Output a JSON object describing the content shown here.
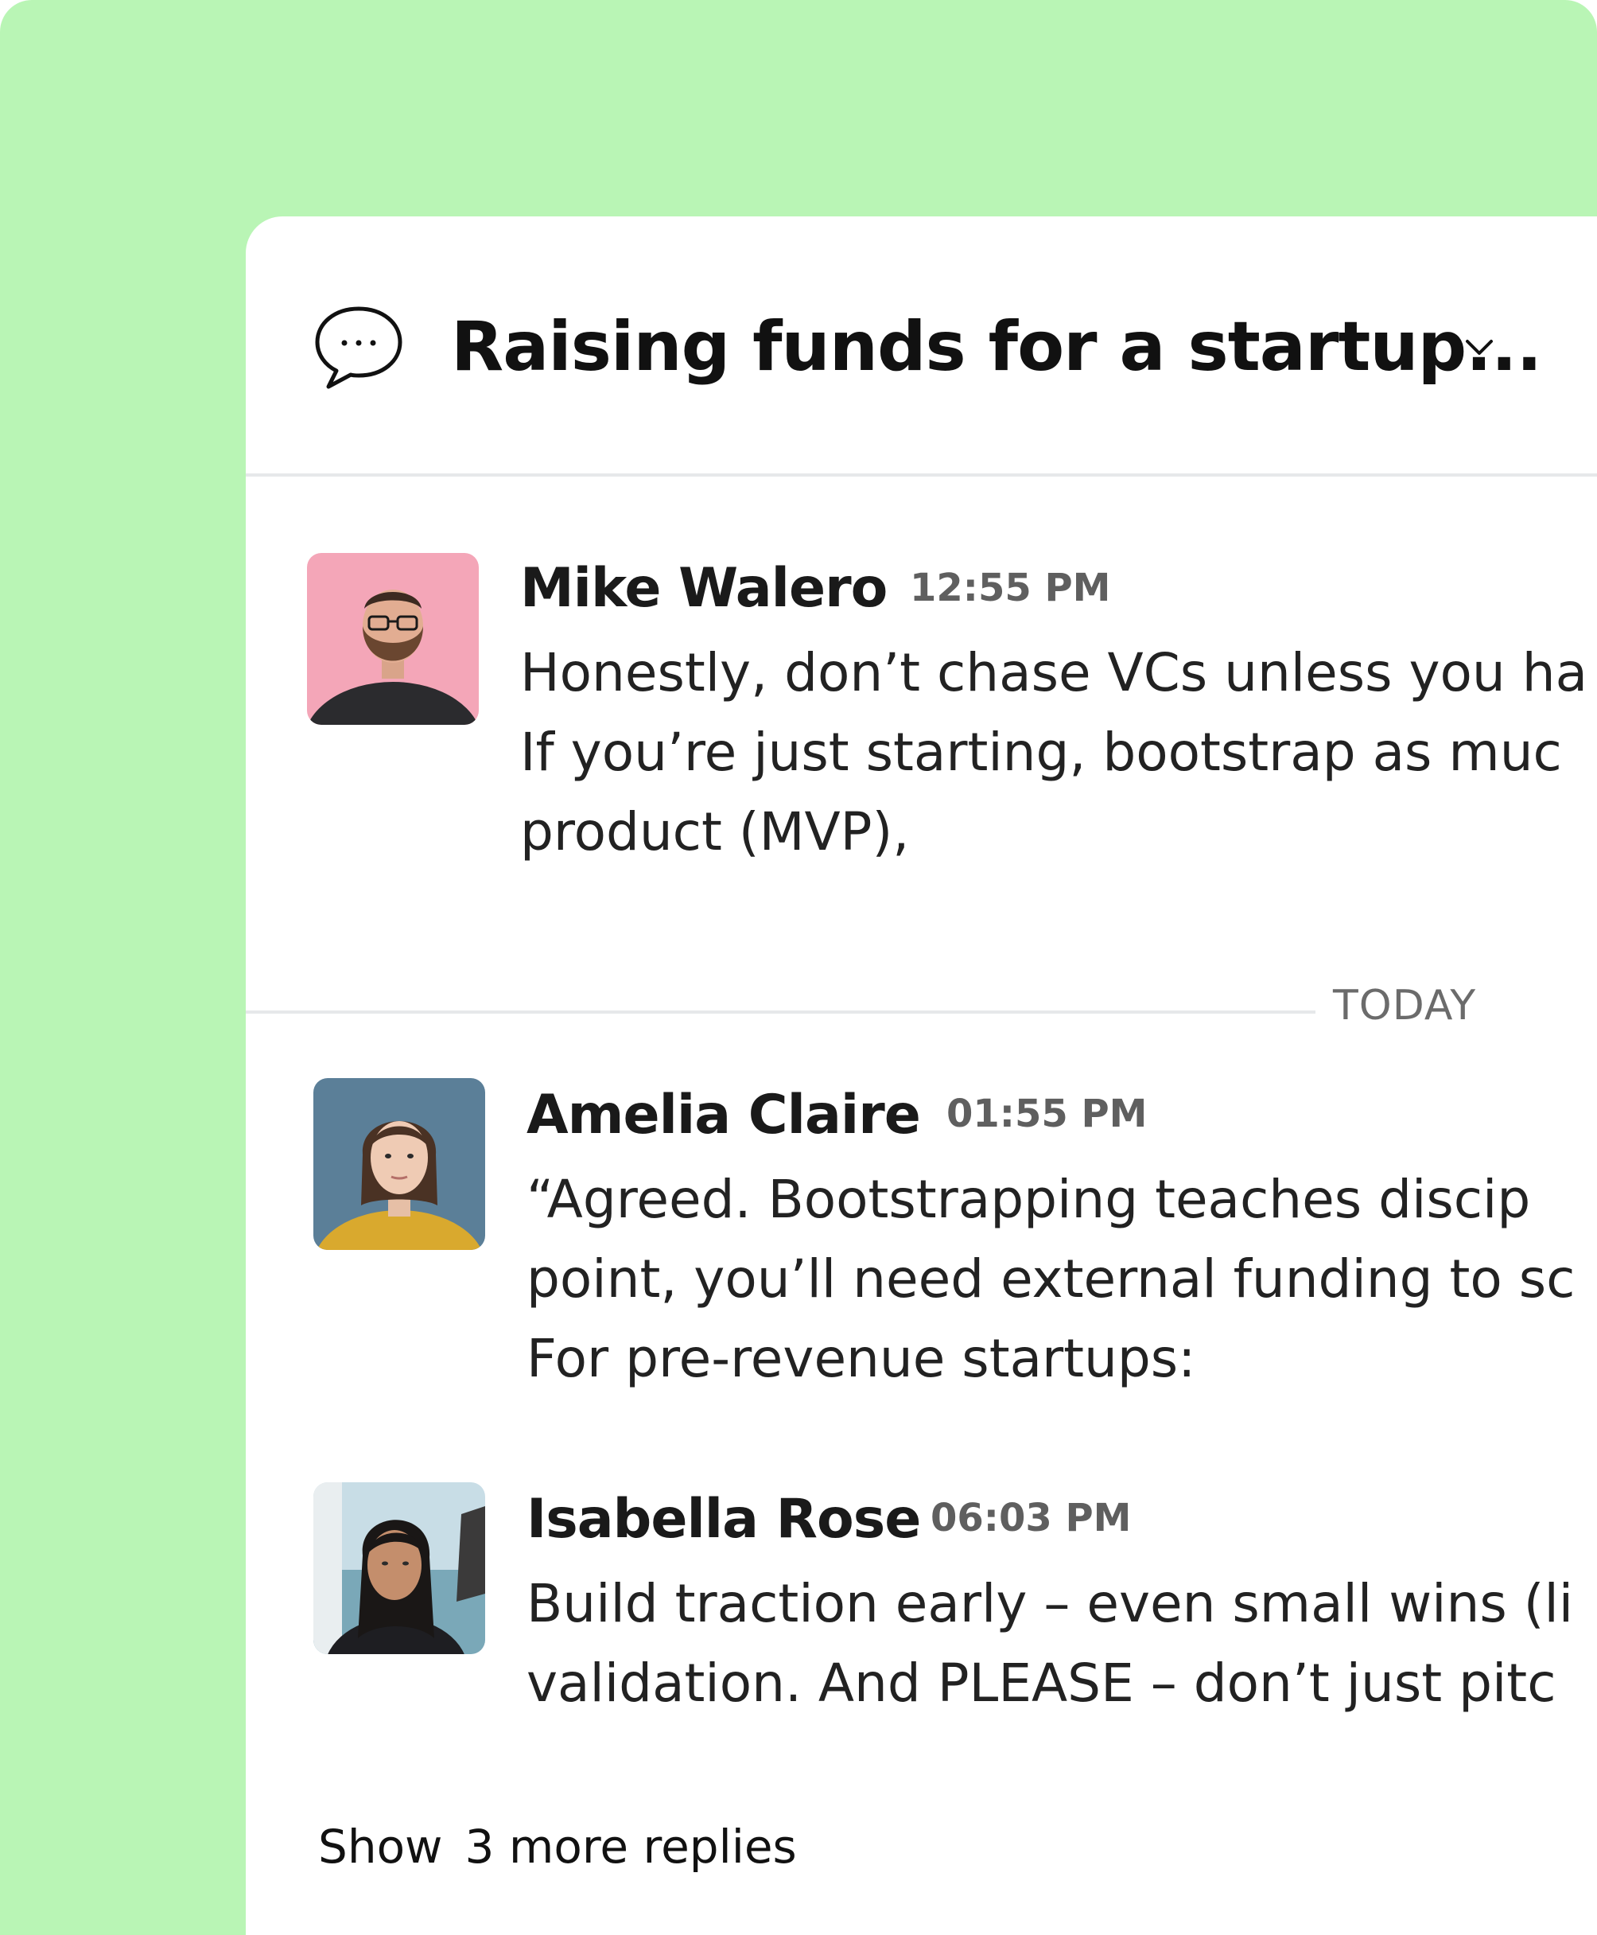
{
  "thread": {
    "title": "Raising funds for a startup...",
    "icon": "chat-bubble-icon"
  },
  "messages": [
    {
      "author": "Mike Walero",
      "time": "12:55 PM",
      "lines": [
        "Honestly, don’t chase VCs unless you ha",
        "If you’re just starting, bootstrap as muc",
        "product (MVP),"
      ]
    },
    {
      "author": "Amelia Claire",
      "time": "01:55 PM",
      "lines": [
        "“Agreed. Bootstrapping teaches discip",
        "point, you’ll need external funding to sc",
        "For pre-revenue startups:"
      ]
    },
    {
      "author": "Isabella Rose",
      "time": "06:03 PM",
      "lines": [
        "Build traction early – even small wins (li",
        "validation. And PLEASE – don’t just pitc"
      ]
    }
  ],
  "divider": {
    "label": "TODAY"
  },
  "footer": {
    "show_label": "Show",
    "more_replies_label": "3 more replies"
  },
  "colors": {
    "background": "#b9f5b5",
    "card": "#ffffff",
    "divider": "#e6e8ea"
  }
}
